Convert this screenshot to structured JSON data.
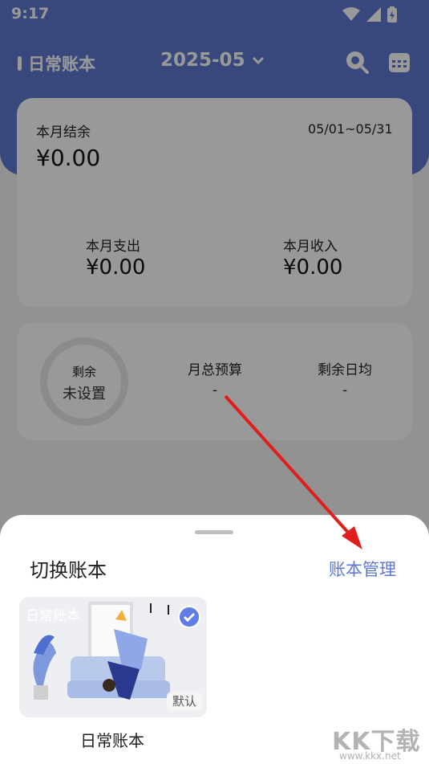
{
  "status_bar": {
    "time": "9:17"
  },
  "header": {
    "book_name": "日常账本",
    "month": "2025-05"
  },
  "summary_card": {
    "balance_label": "本月结余",
    "date_range": "05/01~05/31",
    "balance_value": "¥0.00",
    "expense_label": "本月支出",
    "expense_value": "¥0.00",
    "income_label": "本月收入",
    "income_value": "¥0.00"
  },
  "budget_card": {
    "ring_label": "剩余",
    "ring_value": "未设置",
    "budget_label": "月总预算",
    "budget_value": "-",
    "daily_label": "剩余日均",
    "daily_value": "-"
  },
  "sheet": {
    "title": "切换账本",
    "manage_label": "账本管理",
    "books": [
      {
        "name": "日常账本",
        "caption": "日常账本",
        "badge": "默认",
        "selected": true
      }
    ]
  },
  "watermark": {
    "text": "KK下载",
    "url": "www.kkx.net"
  },
  "colors": {
    "accent": "#5f78cf",
    "arrow": "#e01e1e"
  }
}
